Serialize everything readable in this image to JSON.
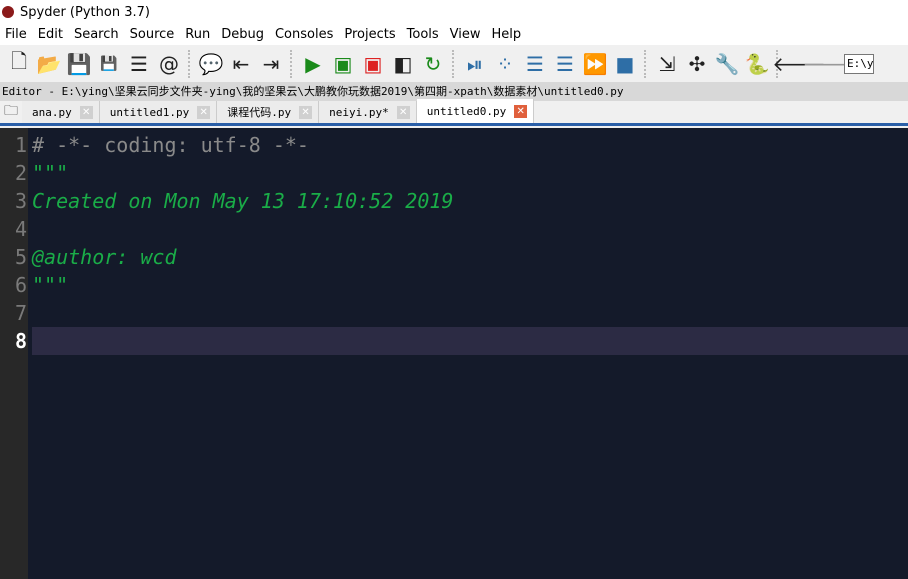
{
  "window": {
    "title": "Spyder (Python 3.7)"
  },
  "menu": [
    "File",
    "Edit",
    "Search",
    "Source",
    "Run",
    "Debug",
    "Consoles",
    "Projects",
    "Tools",
    "View",
    "Help"
  ],
  "toolbar": {
    "address_value": "E:\\y"
  },
  "editor": {
    "path": "Editor - E:\\ying\\坚果云同步文件夹-ying\\我的坚果云\\大鹏教你玩数据2019\\第四期-xpath\\数据素材\\untitled0.py",
    "tabs": [
      {
        "label": "ana.py"
      },
      {
        "label": "untitled1.py"
      },
      {
        "label": "课程代码.py"
      },
      {
        "label": "neiyi.py*"
      },
      {
        "label": "untitled0.py",
        "active": true
      }
    ],
    "lines": [
      {
        "n": "1",
        "text": "# -*- coding: utf-8 -*-",
        "style": "gray"
      },
      {
        "n": "2",
        "text": "\"\"\"",
        "style": "str"
      },
      {
        "n": "3",
        "text": "Created on Mon May 13 17:10:52 2019",
        "style": "str"
      },
      {
        "n": "4",
        "text": "",
        "style": "str"
      },
      {
        "n": "5",
        "text": "@author: wcd",
        "style": "str"
      },
      {
        "n": "6",
        "text": "\"\"\"",
        "style": "str"
      },
      {
        "n": "7",
        "text": "",
        "style": "str"
      },
      {
        "n": "8",
        "text": "",
        "style": "str",
        "current": true
      }
    ]
  },
  "colors": {
    "editor_bg": "#141a2a",
    "comment": "#8a8a8a",
    "string": "#1aad48",
    "current_line": "#2c2b44"
  }
}
